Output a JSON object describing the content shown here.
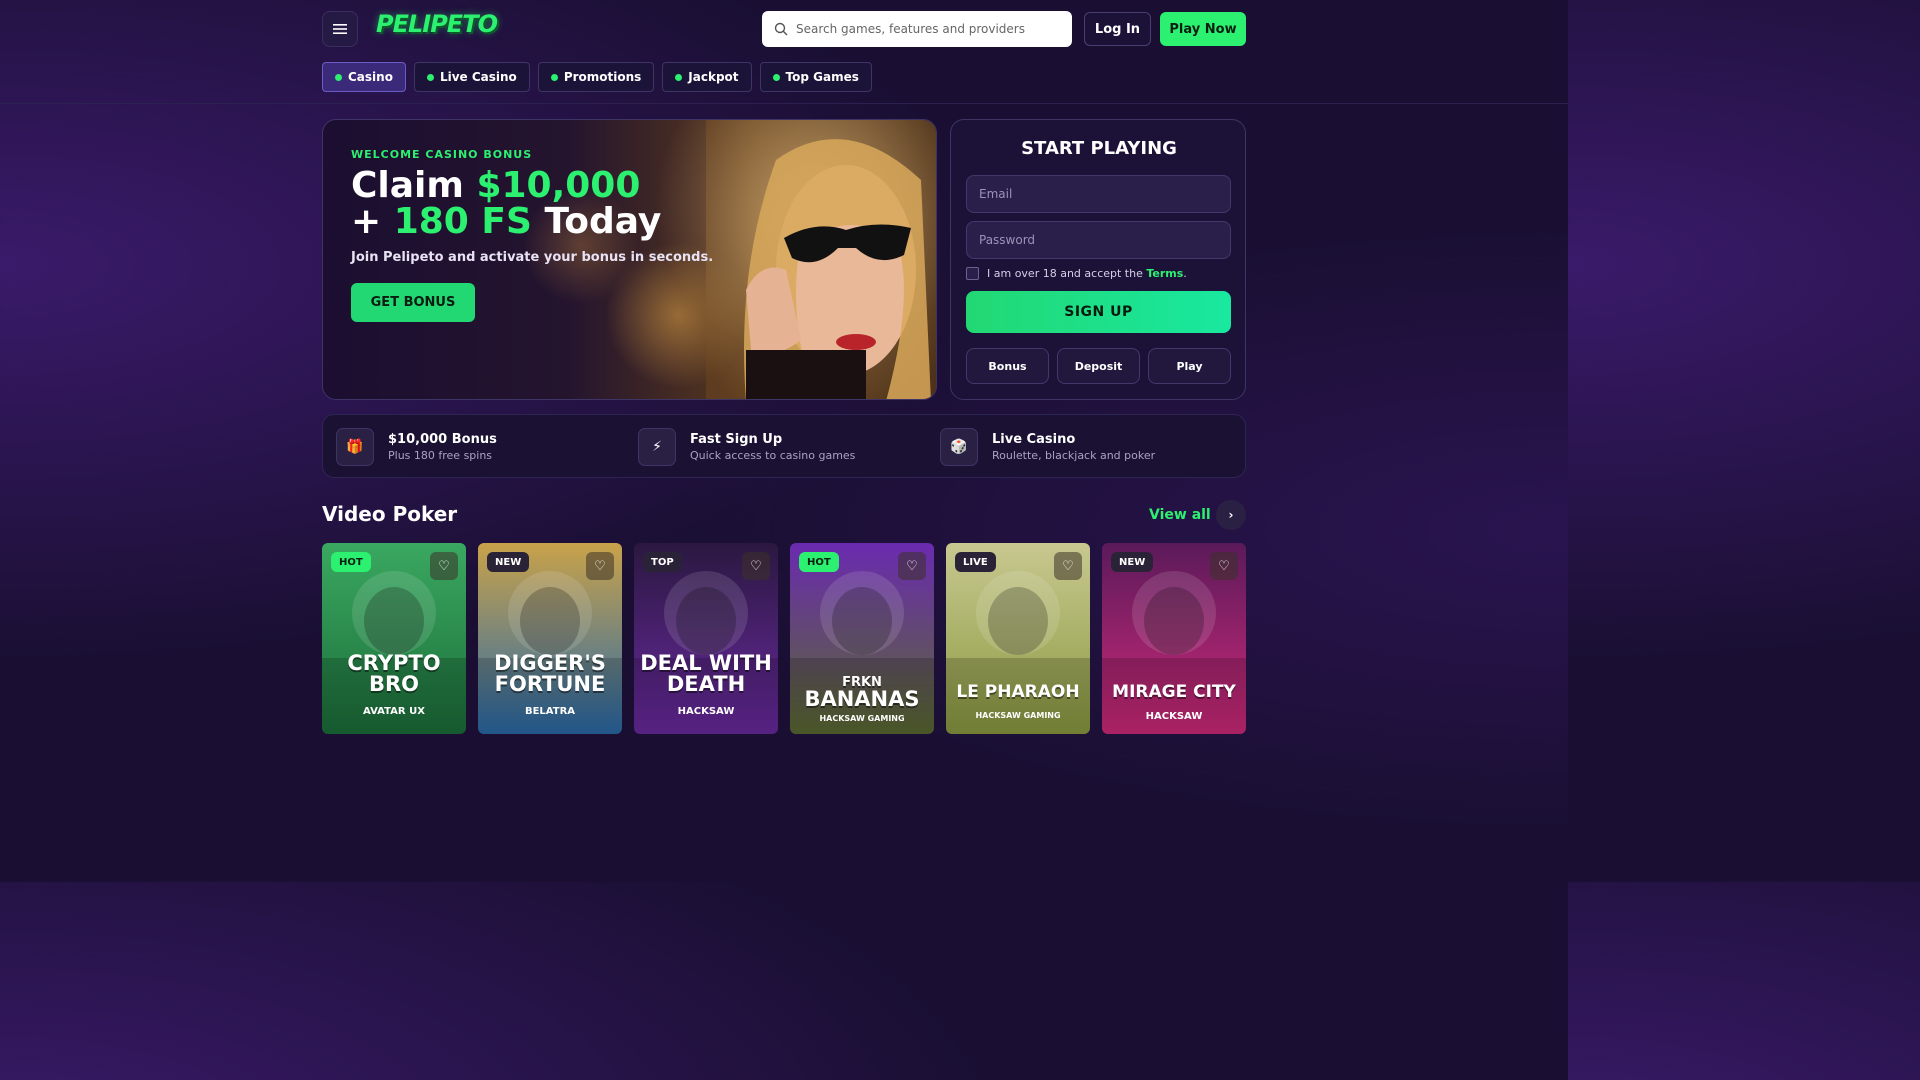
{
  "brand": {
    "logo_text": "PELIPETO",
    "accent": "#2cf06f"
  },
  "header": {
    "search_placeholder": "Search games, features and providers",
    "login_label": "Log In",
    "play_label": "Play Now"
  },
  "nav": {
    "tabs": [
      {
        "label": "Casino",
        "active": true
      },
      {
        "label": "Live Casino",
        "active": false
      },
      {
        "label": "Promotions",
        "active": false
      },
      {
        "label": "Jackpot",
        "active": false
      },
      {
        "label": "Top Games",
        "active": false
      }
    ]
  },
  "hero": {
    "eyebrow": "WELCOME CASINO BONUS",
    "title_line1_prefix": "Claim ",
    "title_line1_amount": "$10,000",
    "title_line2_prefix": "+ ",
    "title_line2_fs": "180 FS",
    "title_line2_suffix": " Today",
    "subtitle": "Join Pelipeto and activate your bonus in seconds.",
    "cta": "GET BONUS"
  },
  "signup": {
    "title": "START PLAYING",
    "email_placeholder": "Email",
    "password_placeholder": "Password",
    "terms_prefix": "I am over 18 and accept the ",
    "terms_link": "Terms",
    "terms_suffix": ".",
    "submit": "SIGN UP",
    "quick_buttons": [
      "Bonus",
      "Deposit",
      "Play"
    ]
  },
  "features": [
    {
      "icon": "gift-icon",
      "glyph": "🎁",
      "title": "$10,000 Bonus",
      "subtitle": "Plus 180 free spins"
    },
    {
      "icon": "lightning-icon",
      "glyph": "⚡",
      "title": "Fast Sign Up",
      "subtitle": "Quick access to casino games"
    },
    {
      "icon": "dice-icon",
      "glyph": "🎲",
      "title": "Live Casino",
      "subtitle": "Roulette, blackjack and poker"
    }
  ],
  "section": {
    "title": "Video Poker",
    "view_all": "View all",
    "arrow": "›"
  },
  "games": [
    {
      "badge": "HOT",
      "name_lines": [
        "CRYPTO",
        "BRO"
      ],
      "provider": "AVATAR UX",
      "bg": [
        "#3aa860",
        "#1c6e3a"
      ]
    },
    {
      "badge": "NEW",
      "name_lines": [
        "DIGGER'S",
        "FORTUNE"
      ],
      "provider": "BELATRA",
      "bg": [
        "#c9a24a",
        "#2a6aa8"
      ]
    },
    {
      "badge": "TOP",
      "name_lines": [
        "DEAL WITH",
        "DEATH"
      ],
      "provider": "HACKSAW",
      "bg": [
        "#2a1840",
        "#6a2aa0"
      ]
    },
    {
      "badge": "HOT",
      "name_lines": [
        "FRKN",
        "BANANAS"
      ],
      "provider": "HACKSAW GAMING",
      "bg": [
        "#6a2ab0",
        "#5a6a30"
      ]
    },
    {
      "badge": "LIVE",
      "name_lines": [
        "LE PHARAOH"
      ],
      "provider": "HACKSAW GAMING",
      "bg": [
        "#c8c890",
        "#8a9a40"
      ]
    },
    {
      "badge": "NEW",
      "name_lines": [
        "MIRAGE CITY"
      ],
      "provider": "HACKSAW",
      "bg": [
        "#5a1a5a",
        "#d02a7a"
      ]
    }
  ],
  "fav_glyph": "♡"
}
